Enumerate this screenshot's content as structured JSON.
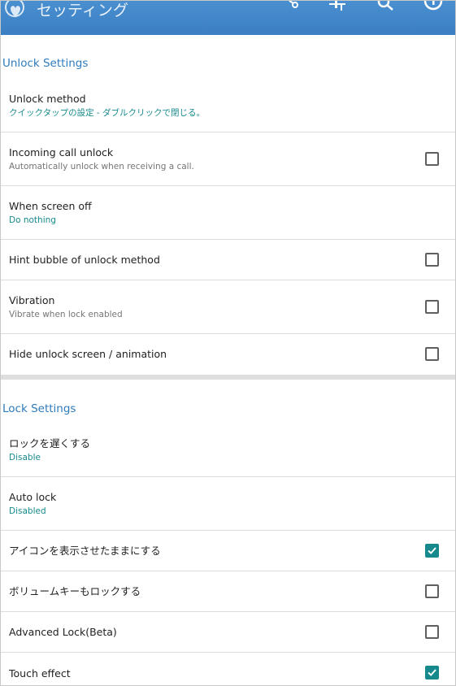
{
  "app": {
    "title": "セッティング"
  },
  "toolbar": {
    "icons": [
      "share-icon",
      "sliders-icon",
      "search-icon",
      "info-icon"
    ]
  },
  "sections": [
    {
      "header": "Unlock Settings",
      "items": [
        {
          "title": "Unlock method",
          "summary": "クイックタップの設定 - ダブルクリックで閉じる。",
          "summary_style": "teal"
        },
        {
          "title": "Incoming call unlock",
          "summary": "Automatically unlock when receiving a call.",
          "summary_style": "gray",
          "checked": false
        },
        {
          "title": "When screen off",
          "summary": "Do nothing",
          "summary_style": "teal"
        },
        {
          "title": "Hint bubble of unlock method",
          "checked": false
        },
        {
          "title": "Vibration",
          "summary": "Vibrate when lock enabled",
          "summary_style": "gray",
          "checked": false
        },
        {
          "title": "Hide unlock screen / animation",
          "checked": false
        }
      ]
    },
    {
      "header": "Lock Settings",
      "items": [
        {
          "title": "ロックを遅くする",
          "summary": "Disable",
          "summary_style": "teal"
        },
        {
          "title": "Auto lock",
          "summary": "Disabled",
          "summary_style": "teal"
        },
        {
          "title": "アイコンを表示させたままにする",
          "checked": true
        },
        {
          "title": "ボリュームキーもロックする",
          "checked": false
        },
        {
          "title": "Advanced Lock(Beta)",
          "checked": false
        },
        {
          "title": "Touch effect",
          "checked": true
        }
      ]
    }
  ],
  "colors": {
    "appbar": "#3a7fc2",
    "section_header": "#2e7bbd",
    "accent_teal": "#16898c",
    "divider": "#dcdcdc"
  }
}
